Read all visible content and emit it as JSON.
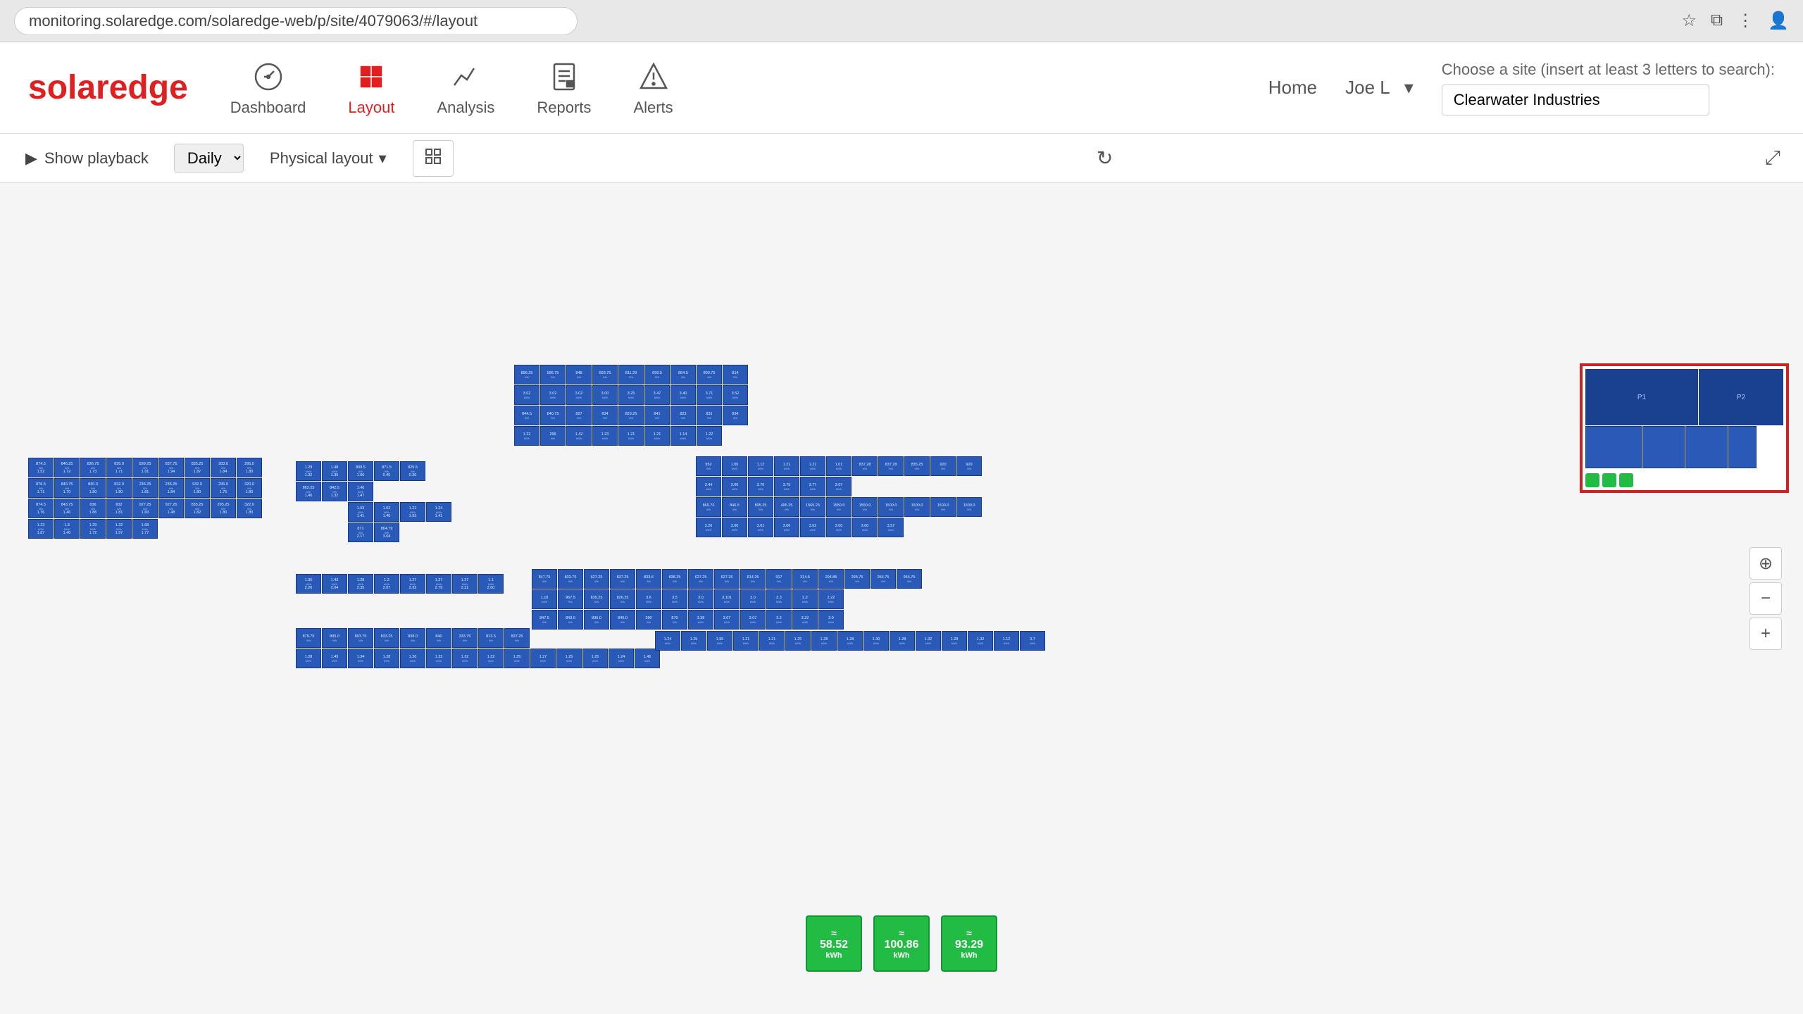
{
  "browser": {
    "url": "monitoring.solaredge.com/solaredge-web/p/site/4079063/#/layout"
  },
  "nav": {
    "logo_text1": "solar",
    "logo_text2": "edge",
    "home_label": "Home",
    "user_label": "Joe L",
    "items": [
      {
        "id": "dashboard",
        "label": "Dashboard"
      },
      {
        "id": "layout",
        "label": "Layout"
      },
      {
        "id": "analysis",
        "label": "Analysis"
      },
      {
        "id": "reports",
        "label": "Reports"
      },
      {
        "id": "alerts",
        "label": "Alerts"
      }
    ]
  },
  "site_search": {
    "label": "Choose a site (insert at least 3 letters to search):",
    "value": "Clearwater Industries",
    "placeholder": ""
  },
  "toolbar": {
    "show_playback": "Show playback",
    "daily_label": "Daily",
    "physical_layout": "Physical layout",
    "refresh_icon": "↻",
    "export_icon": "⤢"
  },
  "inverters": [
    {
      "value": "58.52",
      "unit": "kWh",
      "icon": "≈"
    },
    {
      "value": "100.86",
      "unit": "kWh",
      "icon": "≈"
    },
    {
      "value": "93.29",
      "unit": "kWh",
      "icon": "≈"
    }
  ],
  "zoom": {
    "compass": "⊕",
    "minus": "−",
    "plus": "+"
  }
}
